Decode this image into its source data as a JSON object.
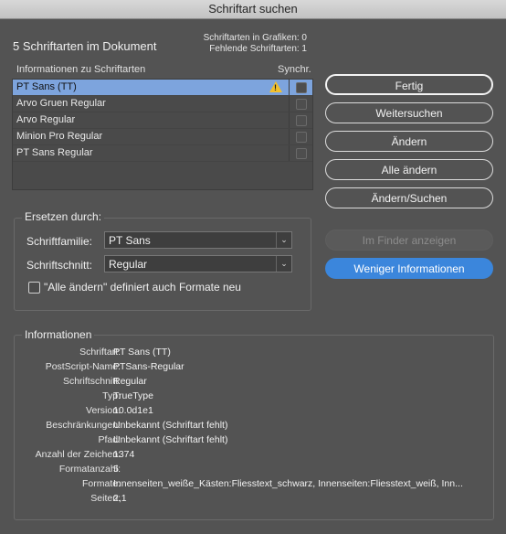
{
  "window": {
    "title": "Schriftart suchen"
  },
  "summary": {
    "fonts_in_document": "5 Schriftarten im Dokument",
    "fonts_in_graphics": "Schriftarten in Grafiken: 0",
    "missing_fonts": "Fehlende Schriftarten: 1"
  },
  "font_list": {
    "col_info": "Informationen zu Schriftarten",
    "col_sync": "Synchr.",
    "rows": [
      {
        "name": "PT Sans (TT)",
        "selected": true,
        "warning": true
      },
      {
        "name": "Arvo Gruen Regular"
      },
      {
        "name": "Arvo Regular"
      },
      {
        "name": "Minion Pro Regular"
      },
      {
        "name": "PT Sans Regular"
      }
    ]
  },
  "buttons": {
    "done": "Fertig",
    "find_next": "Weitersuchen",
    "change": "Ändern",
    "change_all": "Alle ändern",
    "change_find": "Ändern/Suchen",
    "reveal_in_finder": "Im Finder anzeigen",
    "less_info": "Weniger Informationen"
  },
  "replace": {
    "group_label": "Ersetzen durch:",
    "family_label": "Schriftfamilie:",
    "family_value": "PT Sans",
    "style_label": "Schriftschnitt:",
    "style_value": "Regular",
    "redefine_label": "\"Alle ändern\" definiert auch Formate neu"
  },
  "info": {
    "group_label": "Informationen",
    "rows": [
      {
        "key": "Schriftart:",
        "value": "PT Sans (TT)"
      },
      {
        "key": "PostScript-Name:",
        "value": "PTSans-Regular"
      },
      {
        "key": "Schriftschnitt:",
        "value": "Regular"
      },
      {
        "key": "Typ:",
        "value": "TrueType"
      },
      {
        "key": "Version:",
        "value": "10.0d1e1"
      },
      {
        "key": "Beschränkungen:",
        "value": "Unbekannt (Schriftart fehlt)"
      },
      {
        "key": "Pfad:",
        "value": "Unbekannt (Schriftart fehlt)"
      },
      {
        "key": "Anzahl der Zeichen:",
        "value": "1374"
      },
      {
        "key": "Formatanzahl:",
        "value": "5"
      },
      {
        "key": "Formate:",
        "value": "Innenseiten_weiße_Kästen:Fliesstext_schwarz, Innenseiten:Fliesstext_weiß, Inn..."
      },
      {
        "key": "Seiten:",
        "value": "2,1"
      }
    ]
  },
  "colors": {
    "accent": "#3b86dc",
    "selection": "#7da4dd",
    "warning": "#f2c02c"
  }
}
